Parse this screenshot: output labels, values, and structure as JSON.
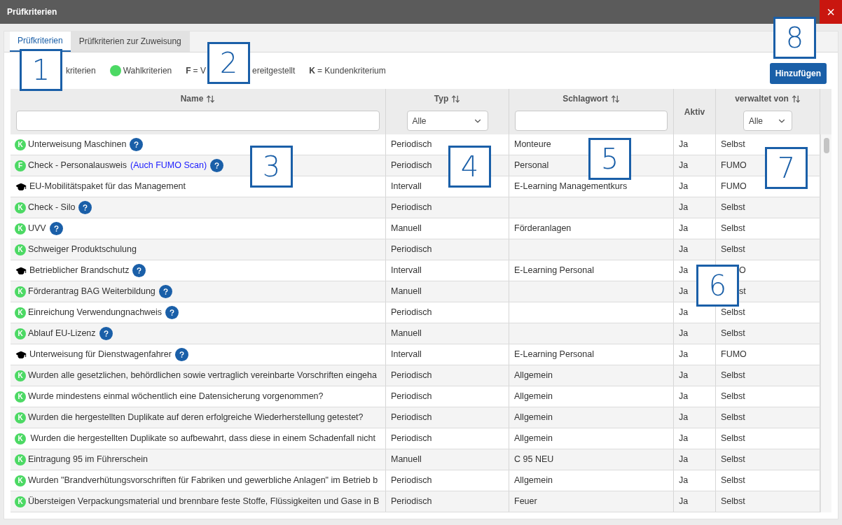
{
  "window": {
    "title": "Prüfkriterien",
    "close": "×"
  },
  "tabs": [
    {
      "label": "Prüfkriterien",
      "selected": true
    },
    {
      "label": "Prüfkriterien zur Zuweisung",
      "selected": false
    }
  ],
  "legend": [
    {
      "kind": "text",
      "text": "kriterien"
    },
    {
      "kind": "dot",
      "color": "#4cd964",
      "text": "Wahlkriterien"
    },
    {
      "kind": "key",
      "key": "F",
      "text": "= V"
    },
    {
      "kind": "text",
      "text": "ereitgestellt"
    },
    {
      "kind": "key",
      "key": "K",
      "text": "= Kundenkriterium"
    }
  ],
  "add_button": "Hinzufügen",
  "table": {
    "columns": [
      {
        "label": "Name",
        "sortable": true,
        "kind": "text"
      },
      {
        "label": "Typ",
        "sortable": true,
        "kind": "select",
        "value": "Alle"
      },
      {
        "label": "Schlagwort",
        "sortable": true,
        "kind": "text"
      },
      {
        "label": "Aktiv",
        "sortable": false,
        "kind": "none"
      },
      {
        "label": "verwaltet von",
        "sortable": true,
        "kind": "select",
        "value": "Alle"
      }
    ],
    "rows": [
      {
        "marker": {
          "kind": "letter",
          "text": "K"
        },
        "name": "Unterweisung Maschinen",
        "help": true,
        "typ": "Periodisch",
        "schlagwort": "Monteure",
        "aktiv": "Ja",
        "verwaltet": "Selbst"
      },
      {
        "marker": {
          "kind": "letter",
          "text": "F"
        },
        "name": "Check - Personalausweis",
        "link": "(Auch FUMO Scan)",
        "help": true,
        "typ": "Periodisch",
        "schlagwort": "Personal",
        "aktiv": "Ja",
        "verwaltet": "FUMO"
      },
      {
        "marker": {
          "kind": "cap"
        },
        "name": "EU-Mobilitätspaket für das Management",
        "help": false,
        "typ": "Intervall",
        "schlagwort": "E-Learning Managementkurs",
        "aktiv": "Ja",
        "verwaltet": "FUMO"
      },
      {
        "marker": {
          "kind": "letter",
          "text": "K"
        },
        "name": "Check - Silo",
        "help": true,
        "typ": "Periodisch",
        "aktiv": "Ja",
        "verwaltet": "Selbst"
      },
      {
        "marker": {
          "kind": "letter",
          "text": "K"
        },
        "name": "UVV",
        "help": true,
        "typ": "Manuell",
        "schlagwort": "Förderanlagen",
        "aktiv": "Ja",
        "verwaltet": "Selbst"
      },
      {
        "marker": {
          "kind": "letter",
          "text": "K"
        },
        "name": "Schweiger Produktschulung",
        "help": false,
        "typ": "Periodisch",
        "aktiv": "Ja",
        "verwaltet": "Selbst"
      },
      {
        "marker": {
          "kind": "cap"
        },
        "name": "Betrieblicher Brandschutz",
        "help": true,
        "typ": "Intervall",
        "schlagwort": "E-Learning Personal",
        "aktiv": "Ja",
        "verwaltet": "O",
        "covered": true
      },
      {
        "marker": {
          "kind": "letter",
          "text": "K"
        },
        "name": "Förderantrag BAG Weiterbildung",
        "help": true,
        "typ": "Manuell",
        "aktiv": "Ja",
        "verwaltet": "st",
        "covered": true
      },
      {
        "marker": {
          "kind": "letter",
          "text": "K"
        },
        "name": "Einreichung Verwendungnachweis",
        "help": true,
        "typ": "Periodisch",
        "aktiv": "Ja",
        "verwaltet": "Selbst"
      },
      {
        "marker": {
          "kind": "letter",
          "text": "K"
        },
        "name": "Ablauf EU-Lizenz",
        "help": true,
        "typ": "Manuell",
        "aktiv": "Ja",
        "verwaltet": "Selbst"
      },
      {
        "marker": {
          "kind": "cap"
        },
        "name": "Unterweisung für Dienstwagenfahrer",
        "help": true,
        "typ": "Intervall",
        "schlagwort": "E-Learning Personal",
        "aktiv": "Ja",
        "verwaltet": "FUMO"
      },
      {
        "marker": {
          "kind": "letter",
          "text": "K"
        },
        "name": "Wurden alle gesetzlichen, behördlichen sowie vertraglich vereinbarte Vorschriften eingeha",
        "help": false,
        "typ": "Periodisch",
        "schlagwort": "Allgemein",
        "aktiv": "Ja",
        "verwaltet": "Selbst"
      },
      {
        "marker": {
          "kind": "letter",
          "text": "K"
        },
        "name": "Wurde mindestens einmal wöchentlich eine Datensicherung vorgenommen?",
        "help": false,
        "typ": "Periodisch",
        "schlagwort": "Allgemein",
        "aktiv": "Ja",
        "verwaltet": "Selbst"
      },
      {
        "marker": {
          "kind": "letter",
          "text": "K"
        },
        "name": "Wurden die hergestellten Duplikate auf deren erfolgreiche Wiederherstellung getestet?",
        "help": false,
        "typ": "Periodisch",
        "schlagwort": "Allgemein",
        "aktiv": "Ja",
        "verwaltet": "Selbst"
      },
      {
        "marker": {
          "kind": "letter",
          "text": "K"
        },
        "name": " Wurden die hergestellten Duplikate so aufbewahrt, dass diese in einem Schadenfall nicht",
        "help": false,
        "typ": "Periodisch",
        "schlagwort": "Allgemein",
        "aktiv": "Ja",
        "verwaltet": "Selbst"
      },
      {
        "marker": {
          "kind": "letter",
          "text": "K"
        },
        "name": "Eintragung 95 im Führerschein",
        "help": false,
        "typ": "Manuell",
        "schlagwort": "C 95 NEU",
        "aktiv": "Ja",
        "verwaltet": "Selbst"
      },
      {
        "marker": {
          "kind": "letter",
          "text": "K"
        },
        "name": "Wurden \"Brandverhütungsvorschriften für Fabriken und gewerbliche Anlagen\" im Betrieb b",
        "help": false,
        "typ": "Periodisch",
        "schlagwort": "Allgemein",
        "aktiv": "Ja",
        "verwaltet": "Selbst"
      },
      {
        "marker": {
          "kind": "letter",
          "text": "K"
        },
        "name": "Übersteigen Verpackungsmaterial und brennbare feste Stoffe, Flüssigkeiten und Gase in B",
        "help": false,
        "typ": "Periodisch",
        "schlagwort": "Feuer",
        "aktiv": "Ja",
        "verwaltet": "Selbst"
      }
    ]
  },
  "annotations": [
    "1",
    "2",
    "3",
    "4",
    "5",
    "6",
    "7",
    "8"
  ]
}
